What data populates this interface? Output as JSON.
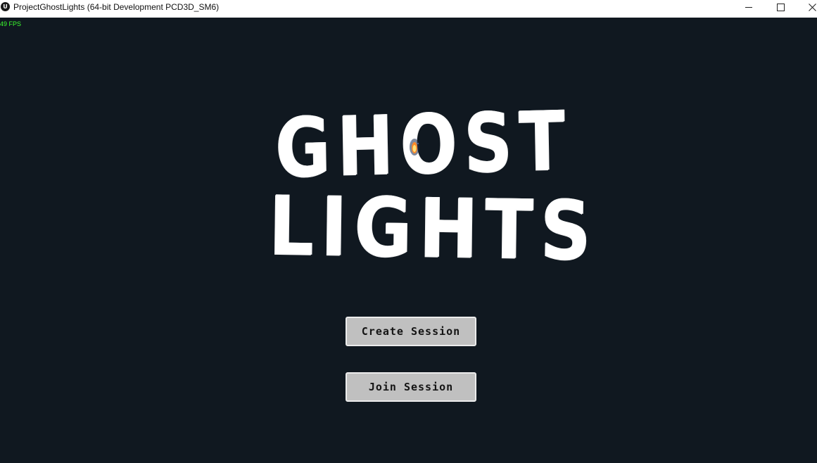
{
  "window": {
    "app_icon_text": "U",
    "title": "ProjectGhostLights (64-bit Development PCD3D_SM6)",
    "controls": {
      "minimize_icon": "minimize-icon",
      "maximize_icon": "maximize-icon",
      "close_icon": "close-icon"
    }
  },
  "hud": {
    "fps": "49 FPS",
    "fps_color": "#3cff2e"
  },
  "logo": {
    "line1": "GHOST",
    "line2": "LIGHTS",
    "color": "#ffffff"
  },
  "menu": {
    "create_session_label": "Create Session",
    "join_session_label": "Join Session"
  },
  "colors": {
    "background": "#101820",
    "button_fill": "#c0c0c0",
    "button_border": "#ececec"
  }
}
